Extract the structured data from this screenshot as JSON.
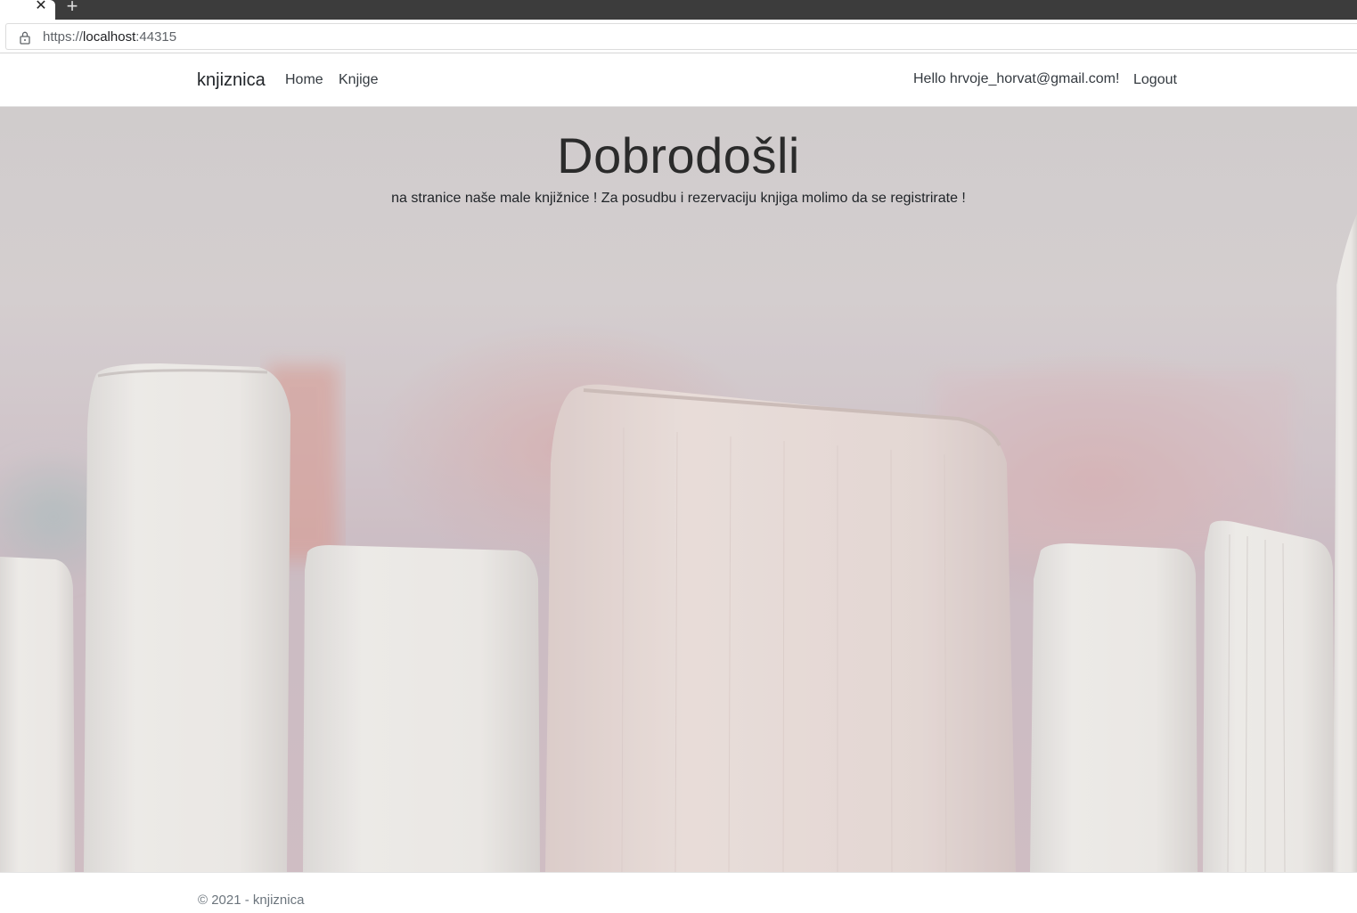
{
  "browser": {
    "close_glyph": "✕",
    "new_tab_glyph": "+",
    "url_scheme": "https://",
    "url_host": "localhost",
    "url_port": ":44315"
  },
  "navbar": {
    "brand": "knjiznica",
    "links": [
      {
        "label": "Home"
      },
      {
        "label": "Knjige"
      }
    ],
    "greeting": "Hello hrvoje_horvat@gmail.com!",
    "logout": "Logout"
  },
  "hero": {
    "title": "Dobrodošli",
    "subtitle": "na stranice naše male knjižnice ! Za posudbu i rezervaciju knjiga molimo da se registrirate !"
  },
  "footer": {
    "text": "© 2021 - knjiznica"
  },
  "colors": {
    "hero_background": "#cfc7ca",
    "book_page": "#eeeae6",
    "book_pink_page": "#e7d8d4"
  },
  "icons": [
    "close-icon",
    "plus-icon",
    "lock-icon"
  ]
}
